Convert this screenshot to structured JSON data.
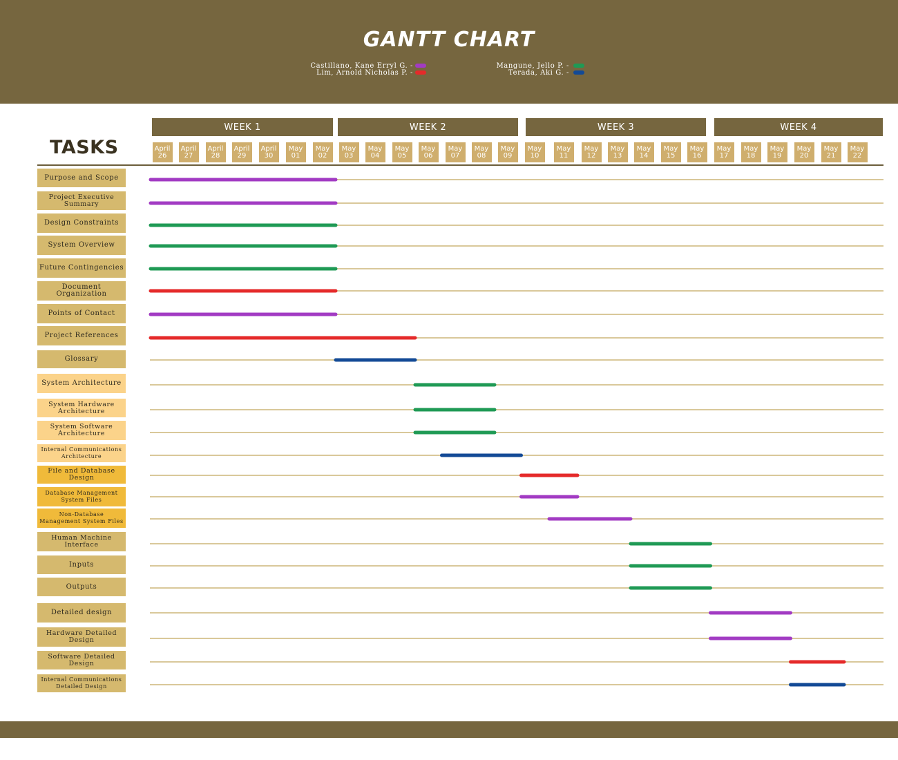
{
  "title": "GANTT CHART",
  "legend": [
    {
      "name": "Castillano, Kane Erryl G. -",
      "color": "#a23bc3",
      "side": "left",
      "row": 0
    },
    {
      "name": "Lim, Arnold Nicholas P. -",
      "color": "#e52a2a",
      "side": "left",
      "row": 1
    },
    {
      "name": "Mangune, Jello P. -",
      "color": "#1f9a55",
      "side": "right",
      "row": 0
    },
    {
      "name": "Terada, Aki G. -",
      "color": "#134a96",
      "side": "right",
      "row": 1
    }
  ],
  "tasks_heading": "TASKS",
  "colors": {
    "header": "#76663f",
    "day_box": "#cfae6d",
    "row_line": "#d9c89a",
    "label_default": "#d5b96e",
    "label_light": "#fbd38a",
    "label_bright": "#f0ba3a"
  },
  "chart_data": {
    "type": "gantt",
    "title": "GANTT CHART",
    "weeks": [
      {
        "label": "WEEK 1",
        "start": 0,
        "end": 6
      },
      {
        "label": "WEEK 2",
        "start": 7,
        "end": 13
      },
      {
        "label": "WEEK 3",
        "start": 14,
        "end": 20
      },
      {
        "label": "WEEK 4",
        "start": 21,
        "end": 26
      }
    ],
    "days": [
      {
        "month": "April",
        "day": "26"
      },
      {
        "month": "April",
        "day": "27"
      },
      {
        "month": "April",
        "day": "28"
      },
      {
        "month": "April",
        "day": "29"
      },
      {
        "month": "April",
        "day": "30"
      },
      {
        "month": "May",
        "day": "01"
      },
      {
        "month": "May",
        "day": "02"
      },
      {
        "month": "May",
        "day": "03"
      },
      {
        "month": "May",
        "day": "04"
      },
      {
        "month": "May",
        "day": "05"
      },
      {
        "month": "May",
        "day": "06"
      },
      {
        "month": "May",
        "day": "07"
      },
      {
        "month": "May",
        "day": "08"
      },
      {
        "month": "May",
        "day": "09"
      },
      {
        "month": "May",
        "day": "10"
      },
      {
        "month": "May",
        "day": "11"
      },
      {
        "month": "May",
        "day": "12"
      },
      {
        "month": "May",
        "day": "13"
      },
      {
        "month": "May",
        "day": "14"
      },
      {
        "month": "May",
        "day": "15"
      },
      {
        "month": "May",
        "day": "16"
      },
      {
        "month": "May",
        "day": "17"
      },
      {
        "month": "May",
        "day": "18"
      },
      {
        "month": "May",
        "day": "19"
      },
      {
        "month": "May",
        "day": "20"
      },
      {
        "month": "May",
        "day": "21"
      },
      {
        "month": "May",
        "day": "22"
      }
    ],
    "tasks": [
      {
        "name": "Purpose and Scope",
        "assignee": "Castillano, Kane Erryl G.",
        "start": "April 26",
        "end": "May 02",
        "label_color": "default"
      },
      {
        "name": "Project Executive Summary",
        "assignee": "Castillano, Kane Erryl G.",
        "start": "April 26",
        "end": "May 02",
        "label_color": "default"
      },
      {
        "name": "Design Constraints",
        "assignee": "Mangune, Jello P.",
        "start": "April 26",
        "end": "May 02",
        "label_color": "default"
      },
      {
        "name": "System Overview",
        "assignee": "Mangune, Jello P.",
        "start": "April 26",
        "end": "May 02",
        "label_color": "default"
      },
      {
        "name": "Future Contingencies",
        "assignee": "Mangune, Jello P.",
        "start": "April 26",
        "end": "May 02",
        "label_color": "default"
      },
      {
        "name": "Document Organization",
        "assignee": "Lim, Arnold Nicholas P.",
        "start": "April 26",
        "end": "May 02",
        "label_color": "default"
      },
      {
        "name": "Points of Contact",
        "assignee": "Castillano, Kane Erryl G.",
        "start": "April 26",
        "end": "May 02",
        "label_color": "default"
      },
      {
        "name": "Project References",
        "assignee": "Lim, Arnold Nicholas P.",
        "start": "April 26",
        "end": "May 05",
        "label_color": "default"
      },
      {
        "name": "Glossary",
        "assignee": "Terada, Aki G.",
        "start": "May 03",
        "end": "May 05",
        "label_color": "default"
      },
      {
        "name": "System Architecture",
        "assignee": "Mangune, Jello P.",
        "start": "May 06",
        "end": "May 08",
        "label_color": "light"
      },
      {
        "name": "System Hardware Architecture",
        "assignee": "Mangune, Jello P.",
        "start": "May 06",
        "end": "May 08",
        "label_color": "light"
      },
      {
        "name": "System Software Architecture",
        "assignee": "Mangune, Jello P.",
        "start": "May 06",
        "end": "May 08",
        "label_color": "light"
      },
      {
        "name": "Internal Communications Architecture",
        "assignee": "Terada, Aki G.",
        "start": "May 07",
        "end": "May 09",
        "label_color": "light"
      },
      {
        "name": "File and Database Design",
        "assignee": "Lim, Arnold Nicholas P.",
        "start": "May 10",
        "end": "May 11",
        "label_color": "bright"
      },
      {
        "name": "Database Management System Files",
        "assignee": "Castillano, Kane Erryl G.",
        "start": "May 10",
        "end": "May 11",
        "label_color": "bright"
      },
      {
        "name": "Non-Database Management System Files",
        "assignee": "Castillano, Kane Erryl G.",
        "start": "May 11",
        "end": "May 13",
        "label_color": "bright"
      },
      {
        "name": "Human Machine Interface",
        "assignee": "Mangune, Jello P.",
        "start": "May 14",
        "end": "May 16",
        "label_color": "default"
      },
      {
        "name": "Inputs",
        "assignee": "Mangune, Jello P.",
        "start": "May 14",
        "end": "May 16",
        "label_color": "default"
      },
      {
        "name": "Outputs",
        "assignee": "Mangune, Jello P.",
        "start": "May 14",
        "end": "May 16",
        "label_color": "default"
      },
      {
        "name": "Detailed design",
        "assignee": "Castillano, Kane Erryl G.",
        "start": "May 17",
        "end": "May 19",
        "label_color": "default"
      },
      {
        "name": "Hardware Detailed Design",
        "assignee": "Castillano, Kane Erryl G.",
        "start": "May 17",
        "end": "May 19",
        "label_color": "default"
      },
      {
        "name": "Software Detailed Design",
        "assignee": "Lim, Arnold Nicholas P.",
        "start": "May 20",
        "end": "May 21",
        "label_color": "default"
      },
      {
        "name": "Internal Communications Detailed Design",
        "assignee": "Terada, Aki G.",
        "start": "May 20",
        "end": "May 21",
        "label_color": "default"
      }
    ]
  }
}
